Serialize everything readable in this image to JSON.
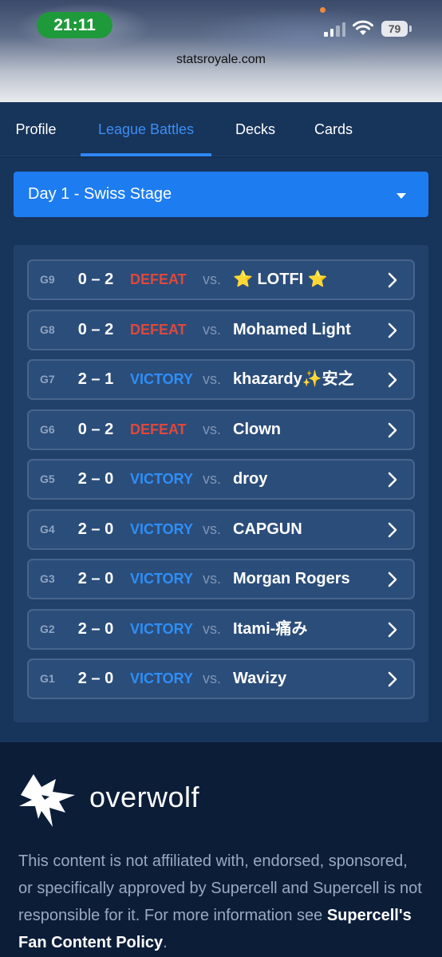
{
  "status_bar": {
    "time": "21:11",
    "battery": "79",
    "signal_icon": "cellular-signal-icon",
    "wifi_icon": "wifi-icon"
  },
  "browser": {
    "url": "statsroyale.com"
  },
  "tabs": [
    {
      "label": "Profile",
      "active": false
    },
    {
      "label": "League Battles",
      "active": true
    },
    {
      "label": "Decks",
      "active": false
    },
    {
      "label": "Cards",
      "active": false
    }
  ],
  "stage_select": {
    "value": "Day 1 - Swiss Stage",
    "icon": "caret-down-icon"
  },
  "battles": [
    {
      "game": "G9",
      "score": "0 – 2",
      "result": "DEFEAT",
      "vs": "vs.",
      "opponent": "⭐ LOTFI ⭐"
    },
    {
      "game": "G8",
      "score": "0 – 2",
      "result": "DEFEAT",
      "vs": "vs.",
      "opponent": "Mohamed Light"
    },
    {
      "game": "G7",
      "score": "2 – 1",
      "result": "VICTORY",
      "vs": "vs.",
      "opponent": "khazardy✨安之"
    },
    {
      "game": "G6",
      "score": "0 – 2",
      "result": "DEFEAT",
      "vs": "vs.",
      "opponent": "Clown"
    },
    {
      "game": "G5",
      "score": "2 – 0",
      "result": "VICTORY",
      "vs": "vs.",
      "opponent": "droy"
    },
    {
      "game": "G4",
      "score": "2 – 0",
      "result": "VICTORY",
      "vs": "vs.",
      "opponent": "CAPGUN"
    },
    {
      "game": "G3",
      "score": "2 – 0",
      "result": "VICTORY",
      "vs": "vs.",
      "opponent": "Morgan Rogers"
    },
    {
      "game": "G2",
      "score": "2 – 0",
      "result": "VICTORY",
      "vs": "vs.",
      "opponent": "Itami-痛み"
    },
    {
      "game": "G1",
      "score": "2 – 0",
      "result": "VICTORY",
      "vs": "vs.",
      "opponent": "Wavizy"
    }
  ],
  "colors": {
    "victory": "#2f8ef5",
    "defeat": "#e0473b",
    "accent": "#1d7cf0"
  },
  "footer": {
    "brand": "overwolf",
    "logo_icon": "overwolf-wolf-icon",
    "disclaimer_text": "This content is not affiliated with, endorsed, sponsored, or specifically approved by Supercell and Supercell is not responsible for it. For more information see ",
    "disclaimer_link": "Supercell's Fan Content Policy",
    "disclaimer_end": "."
  }
}
